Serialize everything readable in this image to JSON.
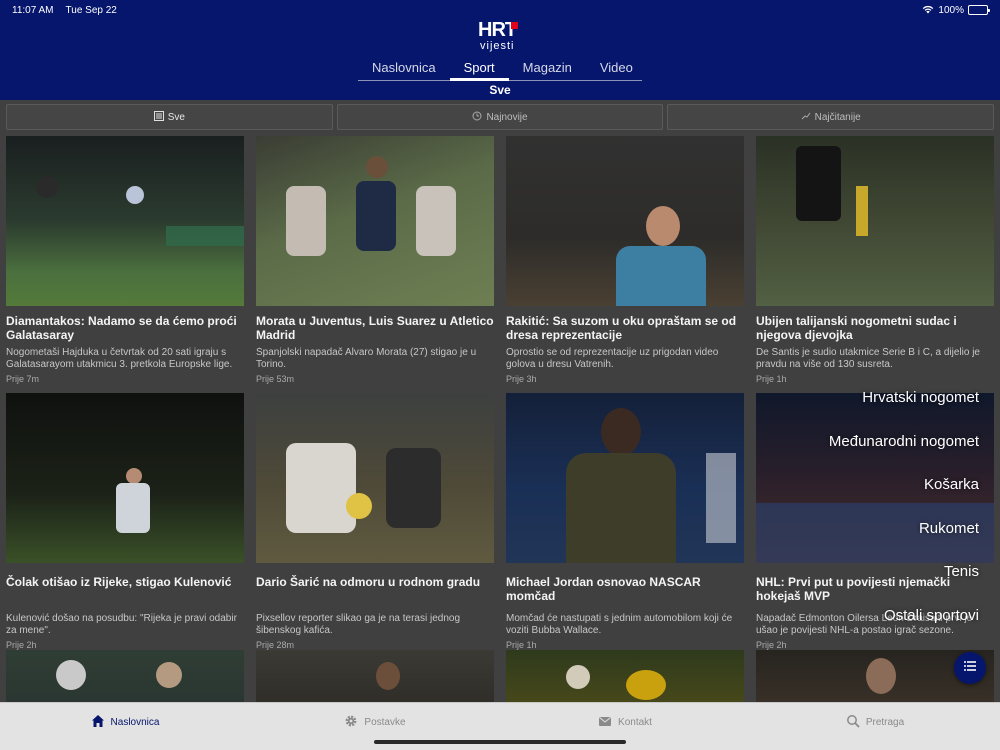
{
  "status": {
    "time": "11:07 AM",
    "date": "Tue Sep 22",
    "battery": "100%"
  },
  "brand": {
    "logo_top": "HRT",
    "logo_bottom": "vijesti",
    "primary_color": "#06166d",
    "accent_color": "#e4001b"
  },
  "nav": {
    "tabs": [
      {
        "label": "Naslovnica"
      },
      {
        "label": "Sport",
        "active": true
      },
      {
        "label": "Magazin"
      },
      {
        "label": "Video"
      }
    ],
    "sub_label": "Sve"
  },
  "filters": [
    {
      "label": "Sve",
      "icon": "list-icon",
      "selected": true
    },
    {
      "label": "Najnovije",
      "icon": "clock-icon",
      "selected": false
    },
    {
      "label": "Najčitanije",
      "icon": "trending-icon",
      "selected": false
    }
  ],
  "articles": [
    {
      "title": "Diamantakos: Nadamo se da ćemo proći Galatasaray",
      "desc": "Nogometaši Hajduka u četvrtak od 20 sati igraju s Galatasarayom utakmicu 3. pretkola Europske lige.",
      "time": "Prije 7m"
    },
    {
      "title": "Morata u Juventus, Luis Suarez u Atletico Madrid",
      "desc": "Španjolski napadač Alvaro Morata (27) stigao je u Torino.",
      "time": "Prije 53m"
    },
    {
      "title": "Rakitić: Sa suzom u oku opraštam se od dresa reprezentacije",
      "desc": "Oprostio se od reprezentacije uz prigodan video golova u dresu Vatrenih.",
      "time": "Prije 3h"
    },
    {
      "title": "Ubijen talijanski nogometni sudac i njegova djevojka",
      "desc": "De Santis je sudio utakmice Serie B i C, a dijelio je pravdu na više od 130 susreta.",
      "time": "Prije 1h"
    },
    {
      "title": "Čolak otišao iz Rijeke, stigao Kulenović",
      "desc": "Kulenović došao na posudbu: \"Rijeka je pravi odabir za mene\".",
      "time": "Prije 2h"
    },
    {
      "title": "Dario Šarić na odmoru u rodnom gradu",
      "desc": "Pixsellov reporter slikao ga je na terasi jednog šibenskog kafića.",
      "time": "Prije 28m"
    },
    {
      "title": "Michael Jordan osnovao NASCAR momčad",
      "desc": "Momčad će nastupati s jednim automobilom koji će voziti Bubba Wallace.",
      "time": "Prije 1h"
    },
    {
      "title": "NHL: Prvi put u povijesti njemački hokejaš MVP",
      "desc": "Napadač Edmonton Oilersa Leon Draisaitl prvi je ušao je povijesti NHL-a postao igrač sezone.",
      "time": "Prije 2h"
    }
  ],
  "sports_menu": [
    {
      "label": "Hrvatski nogomet"
    },
    {
      "label": "Međunarodni nogomet"
    },
    {
      "label": "Košarka"
    },
    {
      "label": "Rukomet"
    },
    {
      "label": "Tenis"
    },
    {
      "label": "Ostali sportovi"
    }
  ],
  "tabbar": [
    {
      "label": "Naslovnica",
      "icon": "home-icon",
      "active": true
    },
    {
      "label": "Postavke",
      "icon": "gear-icon",
      "active": false
    },
    {
      "label": "Kontakt",
      "icon": "mail-icon",
      "active": false
    },
    {
      "label": "Pretraga",
      "icon": "search-icon",
      "active": false
    }
  ]
}
